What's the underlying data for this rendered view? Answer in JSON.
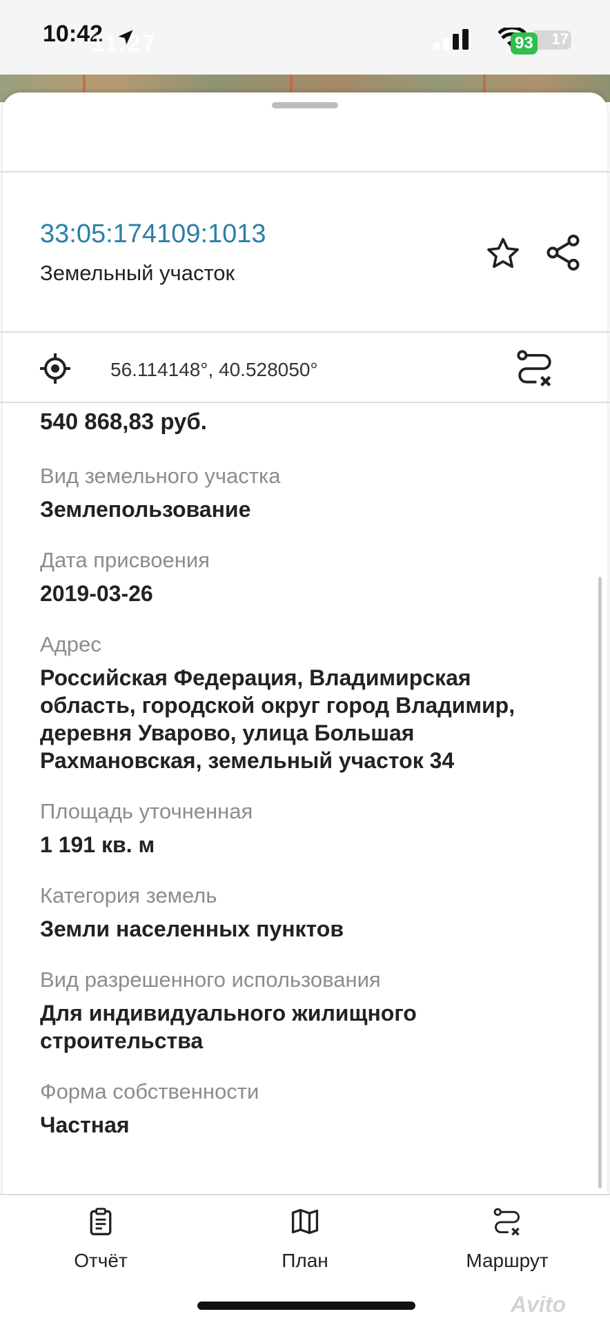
{
  "status_bar": {
    "time": "10:42",
    "time_overlay": "11:27",
    "battery": "93",
    "battery_overlay": "17"
  },
  "parcel": {
    "cadastral_number": "33:05:174109:1013",
    "object_type": "Земельный участок",
    "coordinates": "56.114148°, 40.528050°",
    "price": "540 868,83 руб."
  },
  "fields": [
    {
      "label": "Вид земельного участка",
      "value": "Землепользование"
    },
    {
      "label": "Дата присвоения",
      "value": "2019-03-26"
    },
    {
      "label": "Адрес",
      "value": "Российская Федерация, Владимирская область, городской округ город Владимир, деревня Уварово, улица Большая Рахмановская, земельный участок 34"
    },
    {
      "label": "Площадь уточненная",
      "value": "1 191 кв. м"
    },
    {
      "label": "Категория земель",
      "value": "Земли населенных пунктов"
    },
    {
      "label": "Вид разрешенного использования",
      "value": "Для индивидуального жилищного строительства"
    },
    {
      "label": "Форма собственности",
      "value": "Частная"
    }
  ],
  "bottom_nav": {
    "report": "Отчёт",
    "plan": "План",
    "route": "Маршрут"
  },
  "watermark": "Avito",
  "icons": {
    "favorite": "star-icon",
    "share": "share-icon",
    "locate": "crosshair-icon",
    "route": "route-icon",
    "report": "clipboard-icon",
    "plan": "map-icon"
  }
}
